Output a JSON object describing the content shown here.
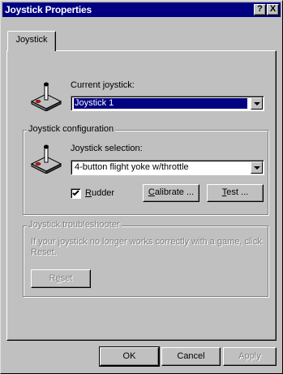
{
  "window": {
    "title": "Joystick Properties"
  },
  "title_buttons": {
    "help": "?",
    "close": "X"
  },
  "tabs": [
    {
      "label": "Joystick"
    }
  ],
  "current": {
    "label": "Current joystick:",
    "value": "Joystick 1"
  },
  "config": {
    "group_label": "Joystick configuration",
    "selection_label": "Joystick selection:",
    "selection_value": "4-button flight yoke w/throttle",
    "rudder": {
      "label_key": "R",
      "label_rest": "udder",
      "checked": true
    },
    "calibrate": {
      "key": "C",
      "rest": "alibrate ..."
    },
    "test": {
      "key": "T",
      "rest": "est ..."
    }
  },
  "trouble": {
    "group_label": "Joystick troubleshooter",
    "text": "If your joystick no longer works correctly with a game, click Reset.",
    "reset": {
      "pre": "R",
      "key": "e",
      "post": "set"
    }
  },
  "footer": {
    "ok": "OK",
    "cancel": "Cancel",
    "apply": "Apply"
  },
  "icons": {
    "joystick": "joystick-icon"
  }
}
